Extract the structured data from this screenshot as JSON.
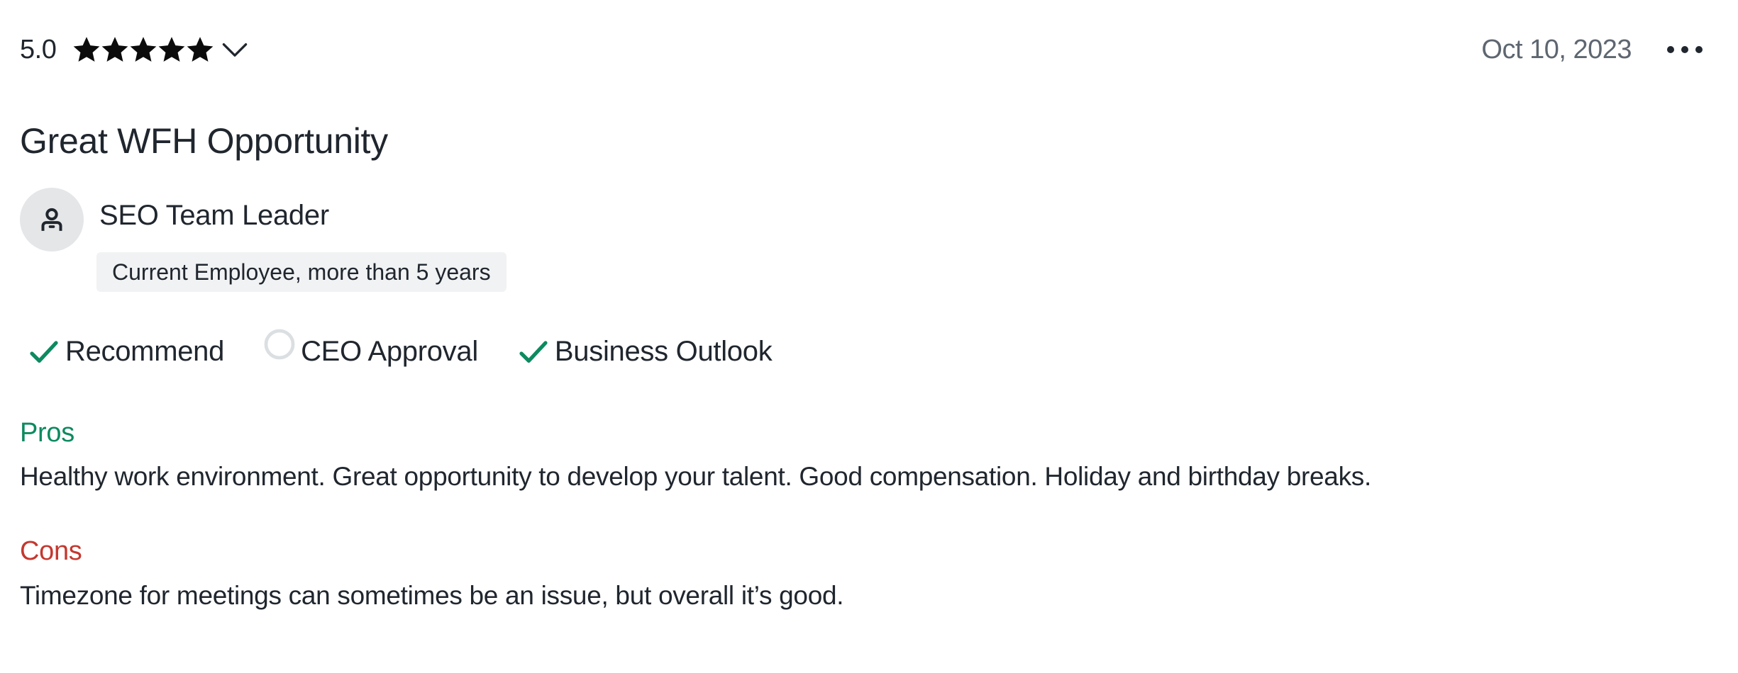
{
  "review": {
    "rating": "5.0",
    "stars_filled": 5,
    "stars_total": 5,
    "date": "Oct 10, 2023",
    "title": "Great WFH Opportunity",
    "author": {
      "job_title": "SEO Team Leader",
      "tenure": "Current Employee, more than 5 years"
    },
    "ratings": {
      "recommend": {
        "label": "Recommend",
        "status": "positive"
      },
      "ceo_approval": {
        "label": "CEO Approval",
        "status": "none"
      },
      "business_outlook": {
        "label": "Business Outlook",
        "status": "positive"
      }
    },
    "pros": {
      "heading": "Pros",
      "text": "Healthy work environment. Great opportunity to develop your talent. Good compensation. Holiday and birthday breaks."
    },
    "cons": {
      "heading": "Cons",
      "text": "Timezone for meetings can sometimes be an issue, but overall it’s good."
    }
  },
  "icons": {
    "star": "star-icon",
    "chevron": "chevron-down-icon",
    "more": "more-horizontal-icon",
    "avatar": "person-icon",
    "positive": "check-icon",
    "neutral": "circle-icon"
  },
  "colors": {
    "text": "#20262e",
    "muted": "#5e6670",
    "positive": "#0d8a5f",
    "negative": "#c4382f",
    "avatar_bg": "#e4e6e8",
    "tag_bg": "#f1f2f3"
  }
}
